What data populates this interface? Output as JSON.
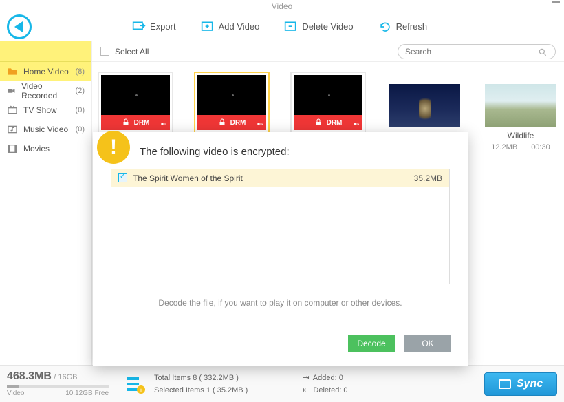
{
  "window": {
    "title": "Video"
  },
  "toolbar": {
    "export": "Export",
    "add_video": "Add Video",
    "delete_video": "Delete Video",
    "refresh": "Refresh"
  },
  "content_header": {
    "select_all": "Select All",
    "search_placeholder": "Search"
  },
  "sidebar": {
    "items": [
      {
        "label": "Home Video",
        "count": "(8)"
      },
      {
        "label": "Video Recorded",
        "count": "(2)"
      },
      {
        "label": "TV Show",
        "count": "(0)"
      },
      {
        "label": "Music Video",
        "count": "(0)"
      },
      {
        "label": "Movies",
        "count": ""
      }
    ]
  },
  "thumbs": {
    "wildlife": {
      "title": "Wildlife",
      "size": "12.2MB",
      "duration": "00:30"
    }
  },
  "dialog": {
    "title": "The following video is encrypted:",
    "row": {
      "name": "The Spirit Women of the Spirit",
      "size": "35.2MB"
    },
    "hint": "Decode the file, if you want to play it on computer or other devices.",
    "decode": "Decode",
    "ok": "OK"
  },
  "footer": {
    "used": "468.3MB",
    "total": "/ 16GB",
    "label": "Video",
    "free": "10.12GB Free",
    "total_items": "Total Items 8  ( 332.2MB )",
    "selected_items": "Selected Items 1  ( 35.2MB )",
    "added": "Added: 0",
    "deleted": "Deleted: 0",
    "sync": "Sync"
  },
  "drm_label": "DRM"
}
